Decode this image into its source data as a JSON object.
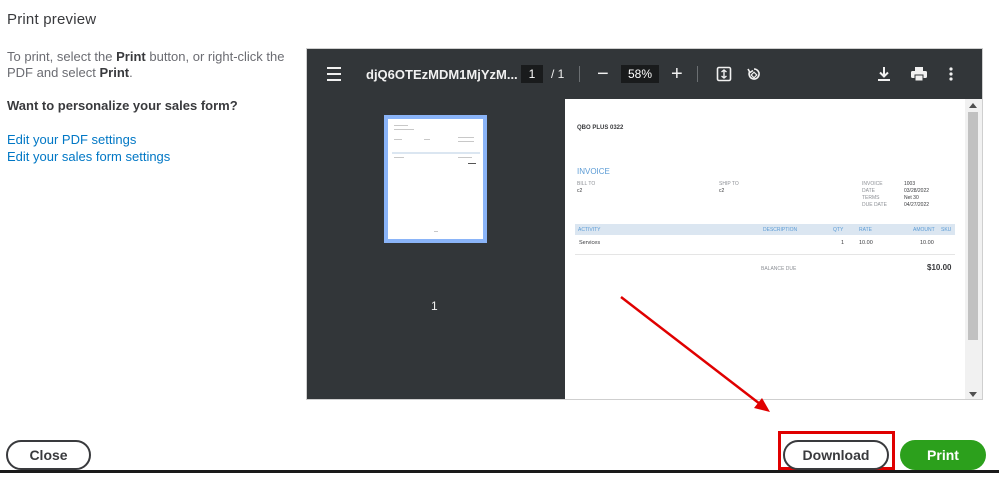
{
  "header": {
    "title": "Print preview"
  },
  "sidebar": {
    "instruction_pre": "To print, select the ",
    "instruction_print": "Print",
    "instruction_mid": " button, or right-click the PDF and select ",
    "instruction_print2": "Print",
    "instruction_end": ".",
    "personalize_heading": "Want to personalize your sales form?",
    "links": [
      "Edit your PDF settings",
      "Edit your sales form settings"
    ]
  },
  "viewer": {
    "doc_title": "djQ6OTEzMDM1MjYzM...",
    "page_current": "1",
    "page_total": "/ 1",
    "zoom": "58%",
    "minus": "−",
    "plus": "+",
    "thumbnail_page": "1",
    "icons": [
      "menu-icon",
      "fit-page-icon",
      "rotate-icon",
      "download-icon",
      "print-icon",
      "more-icon"
    ]
  },
  "invoice": {
    "company": "QBO PLUS 0322",
    "heading": "INVOICE",
    "bill_to_label": "BILL TO",
    "bill_to": "c2",
    "ship_to_label": "SHIP TO",
    "ship_to": "c2",
    "meta": [
      {
        "label": "INVOICE",
        "value": "1003"
      },
      {
        "label": "DATE",
        "value": "03/28/2022"
      },
      {
        "label": "TERMS",
        "value": "Net 30"
      },
      {
        "label": "DUE DATE",
        "value": "04/27/2022"
      }
    ],
    "columns": {
      "activity": "ACTIVITY",
      "description": "DESCRIPTION",
      "qty": "QTY",
      "rate": "RATE",
      "amount": "AMOUNT",
      "sku": "SKU"
    },
    "row": {
      "activity": "Services",
      "qty": "1",
      "rate": "10.00",
      "amount": "10.00"
    },
    "balance_label": "BALANCE DUE",
    "balance": "$10.00"
  },
  "footer": {
    "close_label": "Close",
    "download_label": "Download",
    "print_label": "Print"
  },
  "colors": {
    "accent_link": "#0077c5",
    "print_button": "#2ca01c",
    "annotation_red": "#e00000",
    "viewer_toolbar": "#323639"
  }
}
